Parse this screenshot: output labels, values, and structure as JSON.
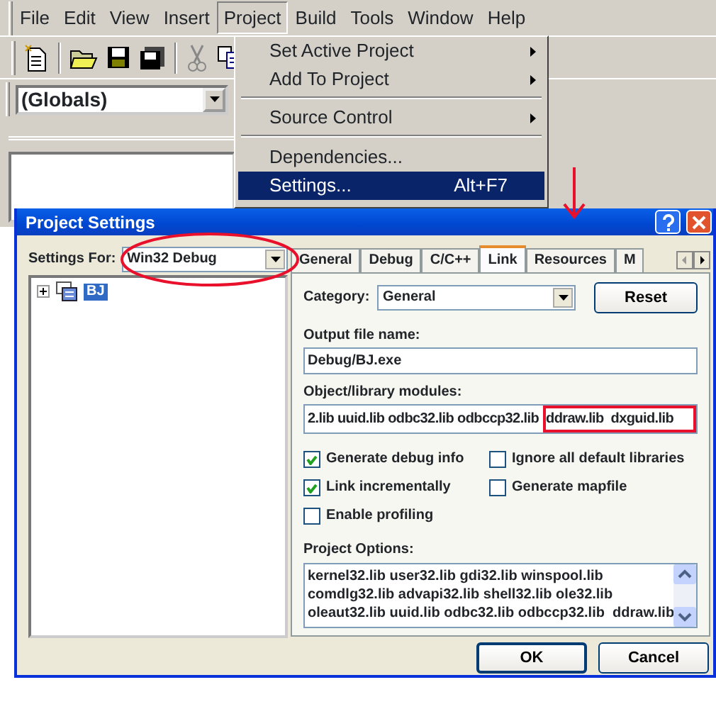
{
  "menubar": [
    {
      "label": "File",
      "selected": false
    },
    {
      "label": "Edit",
      "selected": false
    },
    {
      "label": "View",
      "selected": false
    },
    {
      "label": "Insert",
      "selected": false
    },
    {
      "label": "Project",
      "selected": true
    },
    {
      "label": "Build",
      "selected": false
    },
    {
      "label": "Tools",
      "selected": false
    },
    {
      "label": "Window",
      "selected": false
    },
    {
      "label": "Help",
      "selected": false
    }
  ],
  "globals_combo": {
    "value": "(Globals)"
  },
  "project_menu": [
    {
      "kind": "item",
      "label": "Set Active Project",
      "submenu": true,
      "selected": false
    },
    {
      "kind": "item",
      "label": "Add To Project",
      "submenu": true,
      "selected": false
    },
    {
      "kind": "separator"
    },
    {
      "kind": "item",
      "label": "Source Control",
      "submenu": true,
      "selected": false
    },
    {
      "kind": "separator"
    },
    {
      "kind": "item",
      "label": "Dependencies...",
      "submenu": false,
      "selected": false
    },
    {
      "kind": "item",
      "label": "Settings...",
      "shortcut": "Alt+F7",
      "submenu": false,
      "selected": true
    }
  ],
  "dialog": {
    "title": "Project Settings",
    "settings_for": {
      "label": "Settings For:",
      "value": "Win32 Debug"
    },
    "tree": [
      {
        "label": "BJ",
        "expanded": false,
        "selected": true
      }
    ],
    "tabs": [
      {
        "label": "General",
        "selected": false
      },
      {
        "label": "Debug",
        "selected": false
      },
      {
        "label": "C/C++",
        "selected": false
      },
      {
        "label": "Link",
        "selected": true
      },
      {
        "label": "Resources",
        "selected": false
      },
      {
        "label": "M",
        "selected": false
      }
    ],
    "category": {
      "label": "Category:",
      "value": "General"
    },
    "reset_button": "Reset",
    "output_file": {
      "label": "Output file name:",
      "value": "Debug/BJ.exe"
    },
    "modules": {
      "label": "Object/library modules:",
      "value": "2.lib uuid.lib odbc32.lib odbccp32.lib  ddraw.lib  dxguid.lib"
    },
    "options": [
      {
        "label": "Generate debug info",
        "checked": true
      },
      {
        "label": "Ignore all default libraries",
        "checked": false
      },
      {
        "label": "Link incrementally",
        "checked": true
      },
      {
        "label": "Generate mapfile",
        "checked": false
      },
      {
        "label": "Enable profiling",
        "checked": false
      }
    ],
    "project_options": {
      "label": "Project Options:",
      "lines": [
        "kernel32.lib user32.lib gdi32.lib winspool.lib",
        "comdlg32.lib advapi32.lib shell32.lib ole32.lib",
        "oleaut32.lib uuid.lib odbc32.lib odbccp32.lib  ddraw.lib"
      ]
    },
    "buttons": [
      "OK",
      "Cancel"
    ]
  }
}
